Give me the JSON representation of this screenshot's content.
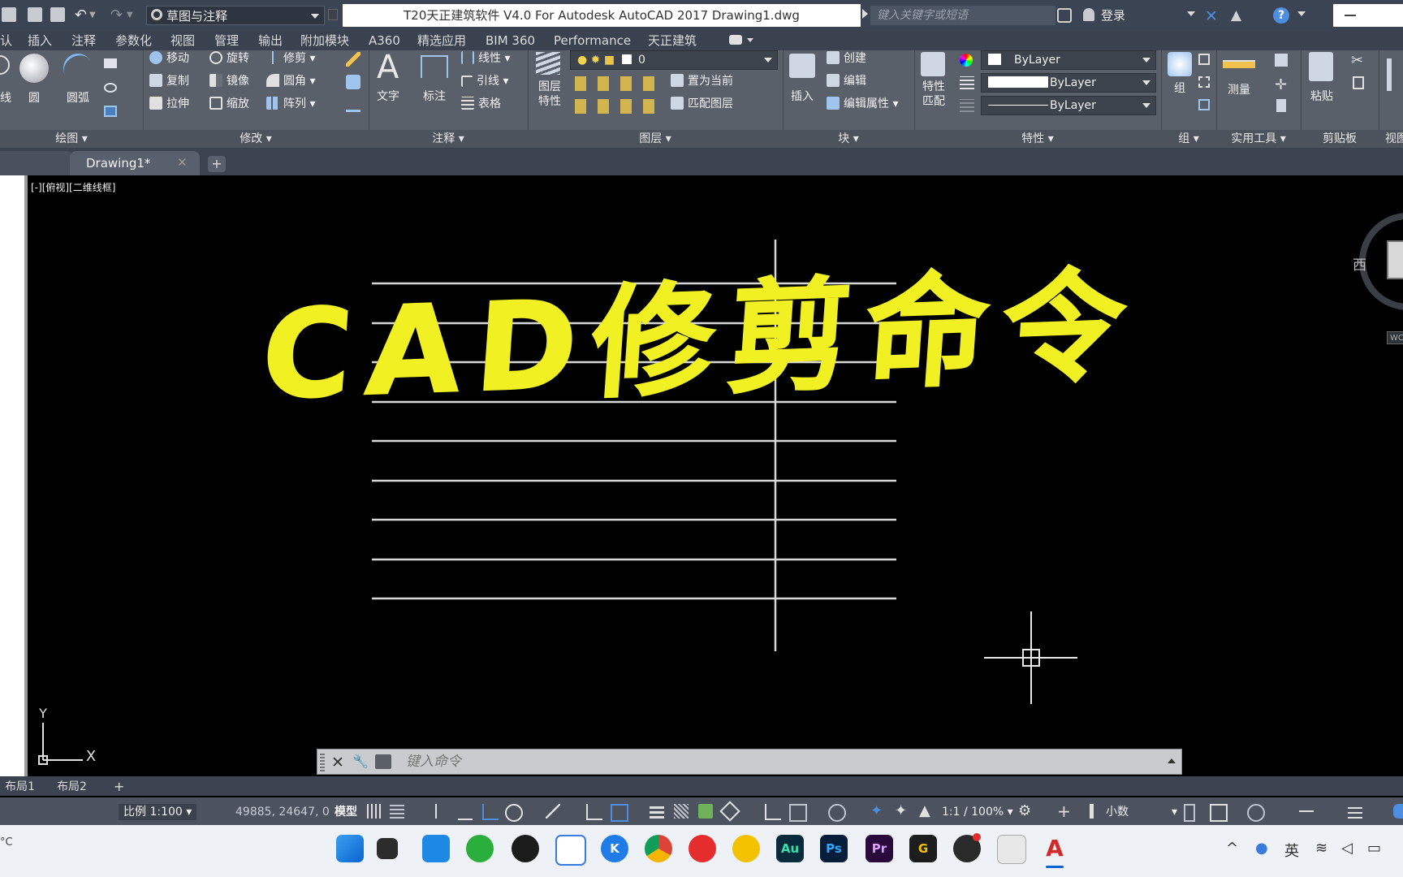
{
  "titlebar": {
    "workspace": "草图与注释",
    "document_title": "T20天正建筑软件 V4.0 For Autodesk AutoCAD 2017    Drawing1.dwg",
    "search_placeholder": "键入关键字或短语",
    "login": "登录"
  },
  "ribbon_tabs": [
    "认",
    "插入",
    "注释",
    "参数化",
    "视图",
    "管理",
    "输出",
    "附加模块",
    "A360",
    "精选应用",
    "BIM 360",
    "Performance",
    "天正建筑"
  ],
  "ribbon": {
    "draw": {
      "label": "绘图",
      "items": [
        "线",
        "圆",
        "圆弧"
      ]
    },
    "modify": {
      "label": "修改",
      "items": [
        "移动",
        "旋转",
        "修剪",
        "复制",
        "镜像",
        "圆角",
        "拉伸",
        "缩放",
        "阵列"
      ]
    },
    "annotation": {
      "label": "注释",
      "text": "文字",
      "dim": "标注",
      "linear": "线性",
      "leader": "引线",
      "table": "表格"
    },
    "layers": {
      "label": "图层",
      "layer_props": "图层\n特性",
      "current_layer": "0",
      "set_current": "置为当前",
      "match_layer": "匹配图层"
    },
    "block": {
      "label": "块",
      "insert": "插入",
      "create": "创建",
      "edit": "编辑",
      "edit_attr": "编辑属性"
    },
    "properties": {
      "label": "特性",
      "match": "特性\n匹配",
      "color": "ByLayer",
      "lineweight": "ByLayer",
      "linetype": "ByLayer"
    },
    "groups": {
      "label": "组",
      "group": "组"
    },
    "utilities": {
      "label": "实用工具",
      "measure": "测量"
    },
    "clipboard": {
      "label": "剪贴板",
      "paste": "粘贴"
    },
    "view": {
      "label": "视图"
    }
  },
  "doc_tabs": {
    "active": "Drawing1*"
  },
  "viewport_label": "[-][俯视][二维线框]",
  "overlay_title": "CAD修剪命令",
  "compass": {
    "west": "西"
  },
  "ucs": {
    "y": "Y",
    "x": "X"
  },
  "command_line": {
    "placeholder": "键入命令"
  },
  "layout_tabs": [
    "布局1",
    "布局2"
  ],
  "statusbar": {
    "scale": "比例 1:100",
    "coordinates": "49885, 24647, 0",
    "model": "模型",
    "annotation_scale": "1:1 / 100%",
    "units": "小数"
  },
  "taskbar": {
    "apps": [
      "Au",
      "Ps",
      "Pr"
    ],
    "ime": "英"
  },
  "left_edge_text": "°C",
  "colors": {
    "overlay": "#f0f022",
    "canvas": "#000000",
    "line": "#d8d8d8"
  }
}
